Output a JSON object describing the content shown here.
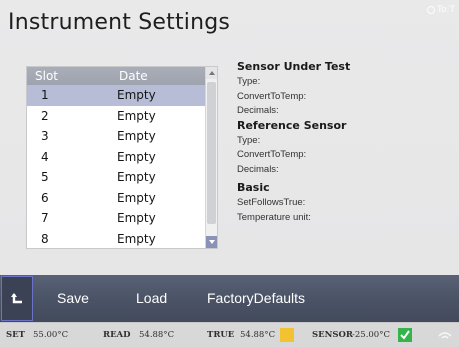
{
  "window": {
    "title": "Instrument Settings",
    "clock_text": "To:T"
  },
  "slot_table": {
    "headers": {
      "slot": "Slot",
      "date": "Date"
    },
    "rows": [
      {
        "slot": "1",
        "date": "Empty",
        "selected": true
      },
      {
        "slot": "2",
        "date": "Empty"
      },
      {
        "slot": "3",
        "date": "Empty"
      },
      {
        "slot": "4",
        "date": "Empty"
      },
      {
        "slot": "5",
        "date": "Empty"
      },
      {
        "slot": "6",
        "date": "Empty"
      },
      {
        "slot": "7",
        "date": "Empty"
      },
      {
        "slot": "8",
        "date": "Empty"
      }
    ]
  },
  "info": {
    "sut": {
      "heading": "Sensor Under Test",
      "type": "Type:",
      "convert": "ConvertToTemp:",
      "decimals": "Decimals:"
    },
    "ref": {
      "heading": "Reference Sensor",
      "type": "Type:",
      "convert": "ConvertToTemp:",
      "decimals": "Decimals:"
    },
    "basic": {
      "heading": "Basic",
      "set_follows_true": "SetFollowsTrue:",
      "temp_unit": "Temperature unit:"
    }
  },
  "toolbar": {
    "back_icon": "back-arrow-icon",
    "save": "Save",
    "load": "Load",
    "factory": "FactoryDefaults"
  },
  "status": {
    "set_label": "SET",
    "set_value": "55.00°C",
    "read_label": "READ",
    "read_value": "54.88°C",
    "true_label": "TRUE",
    "true_value": "54.88°C",
    "sensor_label": "SENSOR",
    "sensor_value": "-25.00°C",
    "colors": {
      "warning": "#f2c230",
      "ok": "#36b34a"
    }
  }
}
